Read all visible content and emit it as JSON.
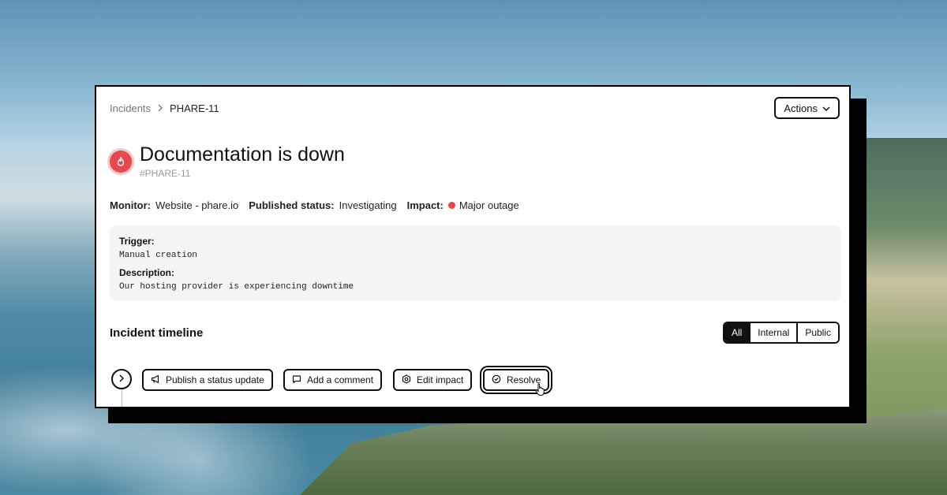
{
  "breadcrumb": {
    "root": "Incidents",
    "current": "PHARE-11"
  },
  "actions": {
    "label": "Actions"
  },
  "incident": {
    "title": "Documentation is down",
    "id": "#PHARE-11"
  },
  "meta": {
    "monitor_label": "Monitor:",
    "monitor_value": "Website - phare.io",
    "status_label": "Published status:",
    "status_value": "Investigating",
    "impact_label": "Impact:",
    "impact_value": "Major outage",
    "impact_color": "#e5484d"
  },
  "details": {
    "trigger_label": "Trigger:",
    "trigger_value": "Manual creation",
    "description_label": "Description:",
    "description_value": "Our hosting provider is experiencing downtime"
  },
  "timeline": {
    "title": "Incident timeline",
    "filters": [
      "All",
      "Internal",
      "Public"
    ],
    "selected_filter": "All",
    "buttons": {
      "publish": "Publish a status update",
      "comment": "Add a comment",
      "edit_impact": "Edit impact",
      "resolve": "Resolve"
    }
  }
}
